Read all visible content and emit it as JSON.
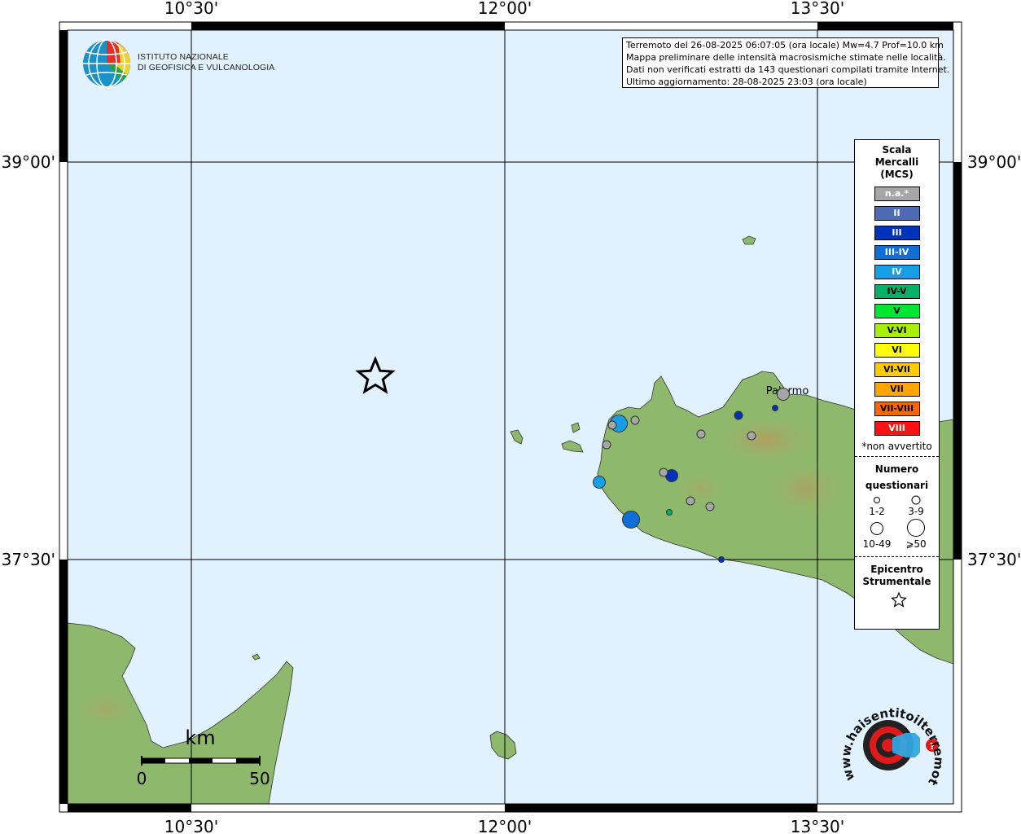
{
  "map": {
    "lon_ticks_top": [
      "10°30'",
      "12°00'",
      "13°30'"
    ],
    "lon_ticks_bottom": [
      "10°30'",
      "12°00'",
      "13°30'"
    ],
    "lat_ticks_left": [
      "39°00'",
      "37°30'"
    ],
    "lat_ticks_right": [
      "39°00'",
      "37°30'"
    ],
    "place_label": "Palermo",
    "epicenter_icon": "star-icon",
    "colors": {
      "sea": "#e1f1fd",
      "land": "#8bb86c",
      "frame": "#000000"
    }
  },
  "logo": {
    "line1": "ISTITUTO NAZIONALE",
    "line2": "DI GEOFISICA E VULCANOLOGIA",
    "icon": "ingv-globe-icon"
  },
  "info": {
    "line1": "Terremoto del 26-08-2025 06:07:05 (ora locale) Mw=4.7 Prof=10.0 km",
    "line2": "Mappa preliminare delle intensità macrosismiche stimate nelle località.",
    "line3": "Dati non verificati estratti da 143 questionari compilati tramite Internet.",
    "line4": "Ultimo aggiornamento: 28-08-2025 23:03 (ora locale)"
  },
  "legend": {
    "title": [
      "Scala",
      "Mercalli",
      "(MCS)"
    ],
    "classes": [
      {
        "label": "n.a.*",
        "color": "#a6a6a6",
        "text": "#ffffff"
      },
      {
        "label": "II",
        "color": "#4d6bb4",
        "text": "#ffffff"
      },
      {
        "label": "III",
        "color": "#0033bb",
        "text": "#ffffff"
      },
      {
        "label": "III-IV",
        "color": "#0f6fd6",
        "text": "#ffffff"
      },
      {
        "label": "IV",
        "color": "#169ee6",
        "text": "#ffffff"
      },
      {
        "label": "IV-V",
        "color": "#06b066",
        "text": "#000000"
      },
      {
        "label": "V",
        "color": "#00e633",
        "text": "#000000"
      },
      {
        "label": "V-VI",
        "color": "#a6f000",
        "text": "#000000"
      },
      {
        "label": "VI",
        "color": "#ffff00",
        "text": "#000000"
      },
      {
        "label": "VI-VII",
        "color": "#ffcc00",
        "text": "#000000"
      },
      {
        "label": "VII",
        "color": "#ffa500",
        "text": "#000000"
      },
      {
        "label": "VII-VIII",
        "color": "#ff6600",
        "text": "#000000"
      },
      {
        "label": "VIII",
        "color": "#ff1111",
        "text": "#ffffff"
      }
    ],
    "note": "*non avvertito",
    "count_title": [
      "Numero",
      "questionari"
    ],
    "sizes": [
      "1-2",
      "3-9",
      "10-49",
      "⩾50"
    ],
    "epicenter_title": [
      "Epicentro",
      "Strumentale"
    ]
  },
  "scalebar": {
    "unit": "km",
    "min": "0",
    "max": "50"
  },
  "badge": {
    "url_text": "www.haisentitoilterremoto.it",
    "icon": "target-speaker-icon"
  },
  "points": [
    {
      "cls": 4,
      "size": 3
    },
    {
      "cls": 3,
      "size": 3
    },
    {
      "cls": 4,
      "size": 2
    },
    {
      "cls": 2,
      "size": 1
    },
    {
      "cls": 2,
      "size": 2
    },
    {
      "cls": 0,
      "size": 1
    },
    {
      "cls": 0,
      "size": 1
    },
    {
      "cls": 0,
      "size": 1
    },
    {
      "cls": 0,
      "size": 1
    },
    {
      "cls": 0,
      "size": 1
    },
    {
      "cls": 0,
      "size": 1
    },
    {
      "cls": 0,
      "size": 1
    },
    {
      "cls": 0,
      "size": 1
    },
    {
      "cls": 2,
      "size": 0
    },
    {
      "cls": 2,
      "size": 0
    },
    {
      "cls": 2,
      "size": 0
    },
    {
      "cls": 5,
      "size": 0
    },
    {
      "cls": 0,
      "size": 2
    }
  ]
}
